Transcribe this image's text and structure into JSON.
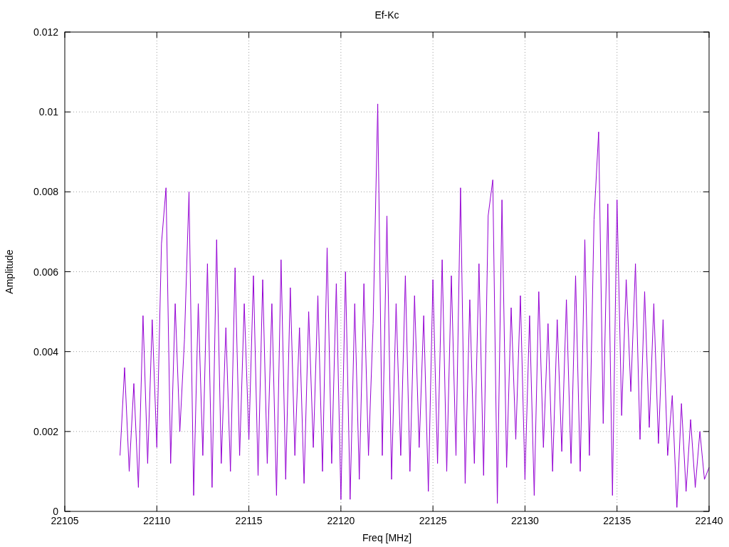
{
  "chart_data": {
    "type": "line",
    "title": "Ef-Kc",
    "xlabel": "Freq [MHz]",
    "ylabel": "Amplitude",
    "grid": true,
    "xlim": [
      22105,
      22140
    ],
    "ylim": [
      0,
      0.012
    ],
    "xticks": [
      22105,
      22110,
      22115,
      22120,
      22125,
      22130,
      22135,
      22140
    ],
    "yticks": [
      0,
      0.002,
      0.004,
      0.006,
      0.008,
      0.01,
      0.012
    ],
    "x": [
      22108,
      22108.25,
      22108.5,
      22108.75,
      22109,
      22109.25,
      22109.5,
      22109.75,
      22110,
      22110.25,
      22110.5,
      22110.75,
      22111,
      22111.25,
      22111.5,
      22111.75,
      22112,
      22112.25,
      22112.5,
      22112.75,
      22113,
      22113.25,
      22113.5,
      22113.75,
      22114,
      22114.25,
      22114.5,
      22114.75,
      22115,
      22115.25,
      22115.5,
      22115.75,
      22116,
      22116.25,
      22116.5,
      22116.75,
      22117,
      22117.25,
      22117.5,
      22117.75,
      22118,
      22118.25,
      22118.5,
      22118.75,
      22119,
      22119.25,
      22119.5,
      22119.75,
      22120,
      22120.25,
      22120.5,
      22120.75,
      22121,
      22121.25,
      22121.5,
      22121.75,
      22122,
      22122.25,
      22122.5,
      22122.75,
      22123,
      22123.25,
      22123.5,
      22123.75,
      22124,
      22124.25,
      22124.5,
      22124.75,
      22125,
      22125.25,
      22125.5,
      22125.75,
      22126,
      22126.25,
      22126.5,
      22126.75,
      22127,
      22127.25,
      22127.5,
      22127.75,
      22128,
      22128.25,
      22128.5,
      22128.75,
      22129,
      22129.25,
      22129.5,
      22129.75,
      22130,
      22130.25,
      22130.5,
      22130.75,
      22131,
      22131.25,
      22131.5,
      22131.75,
      22132,
      22132.25,
      22132.5,
      22132.75,
      22133,
      22133.25,
      22133.5,
      22133.75,
      22134,
      22134.25,
      22134.5,
      22134.75,
      22135,
      22135.25,
      22135.5,
      22135.75,
      22136,
      22136.25,
      22136.5,
      22136.75,
      22137,
      22137.25,
      22137.5,
      22137.75,
      22138,
      22138.25,
      22138.5,
      22138.75,
      22139,
      22139.25,
      22139.5,
      22139.75,
      22140
    ],
    "series": [
      {
        "color": "#9400d3",
        "values": [
          0.0014,
          0.0036,
          0.001,
          0.0032,
          0.0006,
          0.0049,
          0.0012,
          0.0048,
          0.0016,
          0.0067,
          0.0081,
          0.0012,
          0.0052,
          0.002,
          0.0043,
          0.008,
          0.0004,
          0.0052,
          0.0014,
          0.0062,
          0.0006,
          0.0068,
          0.0012,
          0.0046,
          0.001,
          0.0061,
          0.0014,
          0.0052,
          0.0018,
          0.0059,
          0.0009,
          0.0058,
          0.0012,
          0.0052,
          0.0004,
          0.0063,
          0.0008,
          0.0056,
          0.0014,
          0.0046,
          0.0007,
          0.005,
          0.0016,
          0.0054,
          0.001,
          0.0066,
          0.0012,
          0.0057,
          0.0003,
          0.006,
          0.0003,
          0.0052,
          0.0008,
          0.0057,
          0.0014,
          0.0047,
          0.0102,
          0.0014,
          0.0074,
          0.0008,
          0.0052,
          0.0014,
          0.0059,
          0.001,
          0.0054,
          0.0016,
          0.0049,
          0.0005,
          0.0058,
          0.0012,
          0.0063,
          0.001,
          0.0059,
          0.0014,
          0.0081,
          0.0007,
          0.0053,
          0.0012,
          0.0062,
          0.0009,
          0.0074,
          0.0083,
          0.0002,
          0.0078,
          0.0011,
          0.0051,
          0.0018,
          0.0054,
          0.0008,
          0.0049,
          0.0004,
          0.0055,
          0.0016,
          0.0047,
          0.001,
          0.0048,
          0.0015,
          0.0053,
          0.0012,
          0.0059,
          0.001,
          0.0068,
          0.0014,
          0.0073,
          0.0095,
          0.0022,
          0.0077,
          0.0004,
          0.0078,
          0.0024,
          0.0058,
          0.003,
          0.0062,
          0.0018,
          0.0055,
          0.0021,
          0.0052,
          0.0017,
          0.0048,
          0.0014,
          0.0029,
          0.0001,
          0.0027,
          0.0005,
          0.0023,
          0.0006,
          0.002,
          0.0008,
          0.0011
        ]
      }
    ]
  }
}
